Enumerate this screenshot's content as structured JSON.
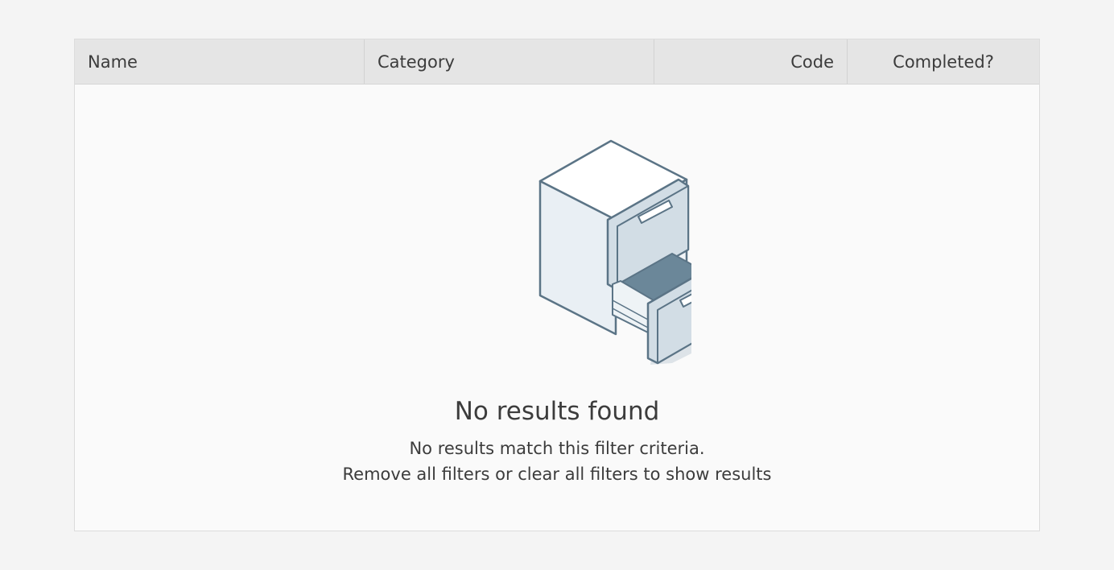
{
  "table": {
    "columns": [
      {
        "label": "Name"
      },
      {
        "label": "Category"
      },
      {
        "label": "Code"
      },
      {
        "label": "Completed?"
      }
    ]
  },
  "empty_state": {
    "illustration": "file-cabinet-icon",
    "title": "No results found",
    "message_line1": "No results match this filter criteria.",
    "message_line2": "Remove all filters or clear all filters to show results"
  },
  "colors": {
    "header_bg": "#e5e5e5",
    "body_bg": "#fafafa",
    "page_bg": "#f4f4f4",
    "illustration_stroke": "#5b7486",
    "illustration_fill": "#d2dde5",
    "illustration_dark": "#6b8799"
  }
}
